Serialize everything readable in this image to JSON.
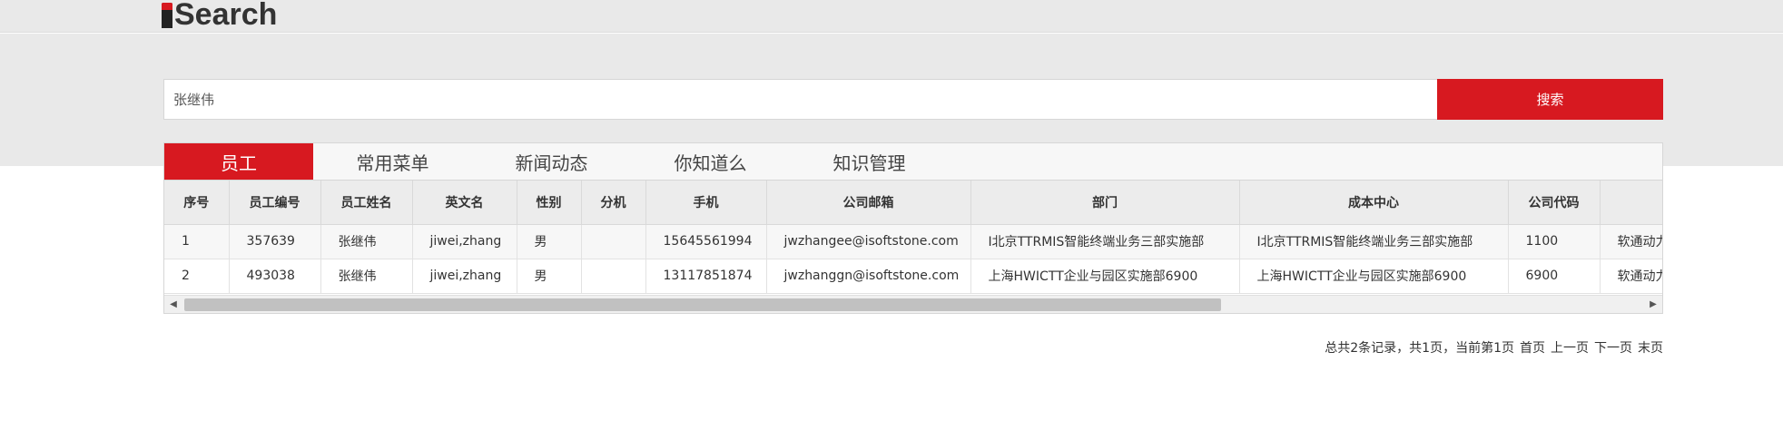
{
  "app": {
    "logo_text": "Search"
  },
  "search": {
    "value": "张继伟",
    "button_label": "搜索"
  },
  "tabs": [
    {
      "label": "员工",
      "active": true
    },
    {
      "label": "常用菜单",
      "active": false
    },
    {
      "label": "新闻动态",
      "active": false
    },
    {
      "label": "你知道么",
      "active": false
    },
    {
      "label": "知识管理",
      "active": false
    }
  ],
  "table": {
    "headers": [
      "序号",
      "员工编号",
      "员工姓名",
      "英文名",
      "性别",
      "分机",
      "手机",
      "公司邮箱",
      "部门",
      "成本中心",
      "公司代码",
      ""
    ],
    "rows": [
      [
        "1",
        "357639",
        "张继伟",
        "jiwei,zhang",
        "男",
        "",
        "15645561994",
        "jwzhangee@isoftstone.com",
        "I北京TTRMIS智能终端业务三部实施部",
        "I北京TTRMIS智能终端业务三部实施部",
        "1100",
        "软通动力"
      ],
      [
        "2",
        "493038",
        "张继伟",
        "jiwei,zhang",
        "男",
        "",
        "13117851874",
        "jwzhanggn@isoftstone.com",
        "上海HWICTT企业与园区实施部6900",
        "上海HWICTT企业与园区实施部6900",
        "6900",
        "软通动力"
      ]
    ]
  },
  "pagination": {
    "summary": "总共2条记录，共1页，当前第1页",
    "first": "首页",
    "prev": "上一页",
    "next": "下一页",
    "last": "末页"
  },
  "colors": {
    "accent": "#d71920",
    "band": "#e9e9e9"
  }
}
